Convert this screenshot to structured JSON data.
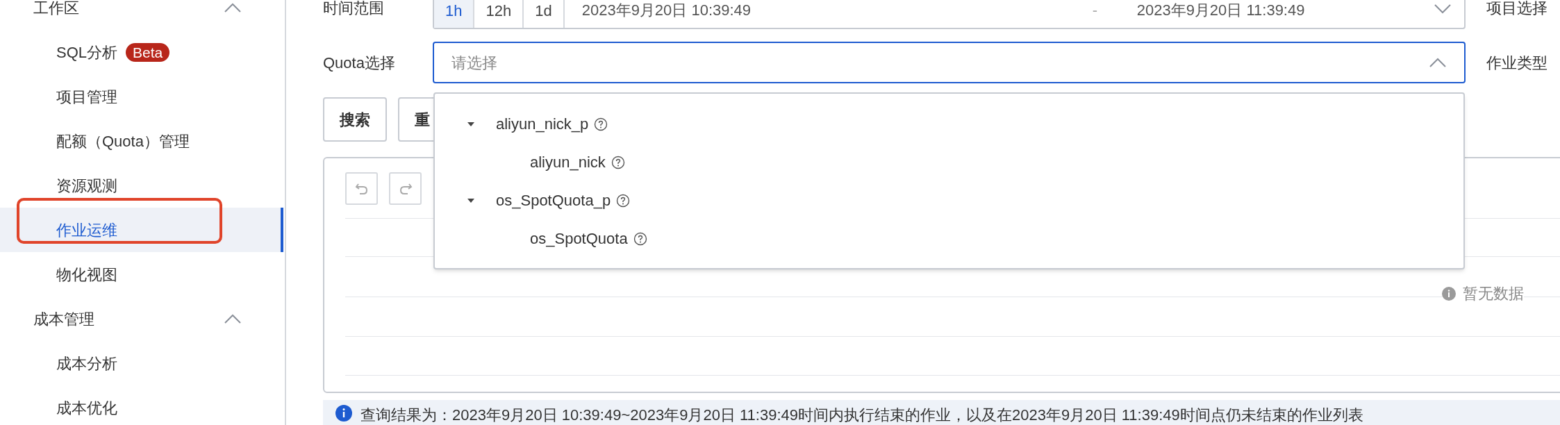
{
  "sidebar": {
    "groups": [
      {
        "label": "工作区",
        "expanded": true,
        "items": [
          {
            "label": "SQL分析",
            "badge": "Beta",
            "selected": false,
            "annotated": false
          },
          {
            "label": "项目管理",
            "selected": false,
            "annotated": false
          },
          {
            "label": "配额（Quota）管理",
            "selected": false,
            "annotated": false
          },
          {
            "label": "资源观测",
            "selected": false,
            "annotated": false
          },
          {
            "label": "作业运维",
            "selected": true,
            "annotated": true
          },
          {
            "label": "物化视图",
            "selected": false,
            "annotated": false
          }
        ]
      },
      {
        "label": "成本管理",
        "expanded": true,
        "items": [
          {
            "label": "成本分析",
            "selected": false,
            "annotated": false
          },
          {
            "label": "成本优化",
            "selected": false,
            "annotated": false
          }
        ]
      }
    ]
  },
  "filters": {
    "time_range": {
      "label": "时间范围",
      "presets": [
        {
          "label": "1h",
          "selected": true
        },
        {
          "label": "12h",
          "selected": false
        },
        {
          "label": "1d",
          "selected": false
        }
      ],
      "start": "2023年9月20日 10:39:49",
      "separator": "-",
      "end": "2023年9月20日 11:39:49"
    },
    "project_label": "项目选择",
    "quota": {
      "label": "Quota选择",
      "placeholder": "请选择",
      "expanded": true
    },
    "job_type_label": "作业类型"
  },
  "buttons": [
    {
      "label": "搜索"
    },
    {
      "label": "重"
    }
  ],
  "quota_dropdown": {
    "items": [
      {
        "label": "aliyun_nick_p",
        "expanded": true,
        "children": [
          {
            "label": "aliyun_nick"
          }
        ]
      },
      {
        "label": "os_SpotQuota_p",
        "expanded": true,
        "children": [
          {
            "label": "os_SpotQuota"
          }
        ]
      }
    ]
  },
  "table": {
    "empty_text": "暂无数据"
  },
  "notice": "查询结果为：2023年9月20日 10:39:49~2023年9月20日 11:39:49时间内执行结束的作业，以及在2023年9月20日 11:39:49时间点仍未结束的作业列表"
}
